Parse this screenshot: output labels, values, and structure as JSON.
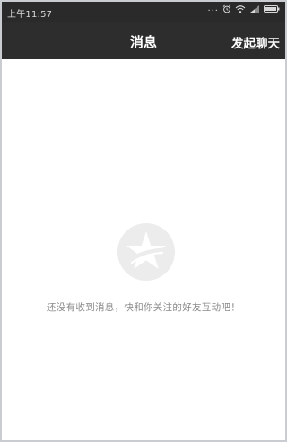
{
  "status_bar": {
    "time": "上午11:57",
    "dots": "...",
    "icons": [
      "alarm-icon",
      "wifi-icon",
      "signal-icon",
      "battery-icon"
    ]
  },
  "header": {
    "title": "消息",
    "start_chat_label": "发起聊天"
  },
  "empty_state": {
    "icon": "star-logo-icon",
    "message": "还没有收到消息，快和你关注的好友互动吧！"
  },
  "colors": {
    "header_bg": "#2d2d2d",
    "status_bg": "#2a2a2a",
    "content_bg": "#ffffff",
    "empty_text": "#8a8a8a",
    "logo_bg": "#ececec"
  }
}
